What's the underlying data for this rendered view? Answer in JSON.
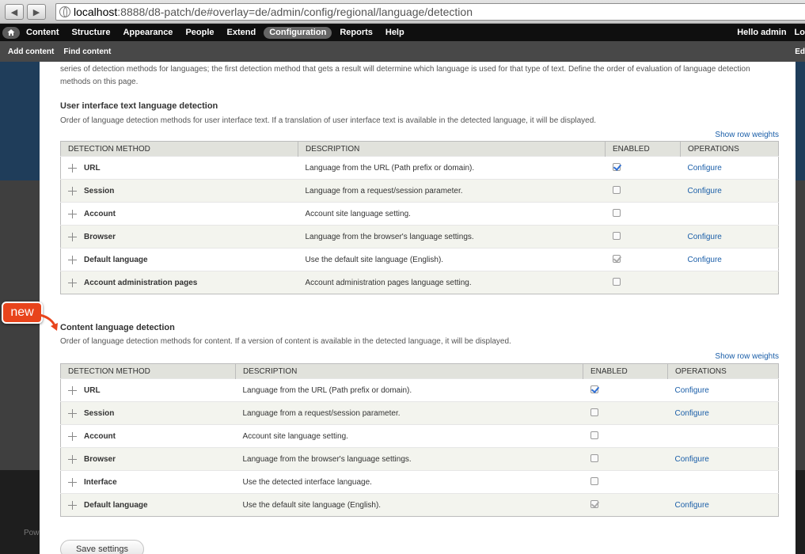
{
  "browser": {
    "url_host": "localhost",
    "url_path": ":8888/d8-patch/de#overlay=de/admin/config/regional/language/detection"
  },
  "toolbar": {
    "items": [
      "Content",
      "Structure",
      "Appearance",
      "People",
      "Extend",
      "Configuration",
      "Reports",
      "Help"
    ],
    "active": "Configuration",
    "user": "Hello admin",
    "logout": "Lo"
  },
  "shortcuts": {
    "add_content": "Add content",
    "find_content": "Find content",
    "edit": "Ed"
  },
  "intro_text": "series of detection methods for languages; the first detection method that gets a result will determine which language is used for that type of text. Define the order of evaluation of language detection methods on this page.",
  "ui_section": {
    "title": "User interface text language detection",
    "description": "Order of language detection methods for user interface text. If a translation of user interface text is available in the detected language, it will be displayed.",
    "show_weights": "Show row weights",
    "headers": [
      "DETECTION METHOD",
      "DESCRIPTION",
      "ENABLED",
      "OPERATIONS"
    ],
    "rows": [
      {
        "method": "URL",
        "description": "Language from the URL (Path prefix or domain).",
        "enabled": "checked",
        "operation": "Configure"
      },
      {
        "method": "Session",
        "description": "Language from a request/session parameter.",
        "enabled": "unchecked",
        "operation": "Configure"
      },
      {
        "method": "Account",
        "description": "Account site language setting.",
        "enabled": "unchecked",
        "operation": ""
      },
      {
        "method": "Browser",
        "description": "Language from the browser's language settings.",
        "enabled": "unchecked",
        "operation": "Configure"
      },
      {
        "method": "Default language",
        "description": "Use the default site language (English).",
        "enabled": "disabled-checked",
        "operation": "Configure"
      },
      {
        "method": "Account administration pages",
        "description": "Account administration pages language setting.",
        "enabled": "unchecked",
        "operation": ""
      }
    ]
  },
  "content_section": {
    "title": "Content language detection",
    "description": "Order of language detection methods for content. If a version of content is available in the detected language, it will be displayed.",
    "show_weights": "Show row weights",
    "headers": [
      "DETECTION METHOD",
      "DESCRIPTION",
      "ENABLED",
      "OPERATIONS"
    ],
    "rows": [
      {
        "method": "URL",
        "description": "Language from the URL (Path prefix or domain).",
        "enabled": "checked",
        "operation": "Configure"
      },
      {
        "method": "Session",
        "description": "Language from a request/session parameter.",
        "enabled": "unchecked",
        "operation": "Configure"
      },
      {
        "method": "Account",
        "description": "Account site language setting.",
        "enabled": "unchecked",
        "operation": ""
      },
      {
        "method": "Browser",
        "description": "Language from the browser's language settings.",
        "enabled": "unchecked",
        "operation": "Configure"
      },
      {
        "method": "Interface",
        "description": "Use the detected interface language.",
        "enabled": "unchecked",
        "operation": ""
      },
      {
        "method": "Default language",
        "description": "Use the default site language (English).",
        "enabled": "disabled-checked",
        "operation": "Configure"
      }
    ]
  },
  "callout": {
    "label": "new",
    "color": "#e8441c"
  },
  "save_button": "Save settings",
  "background_text": "Pow"
}
